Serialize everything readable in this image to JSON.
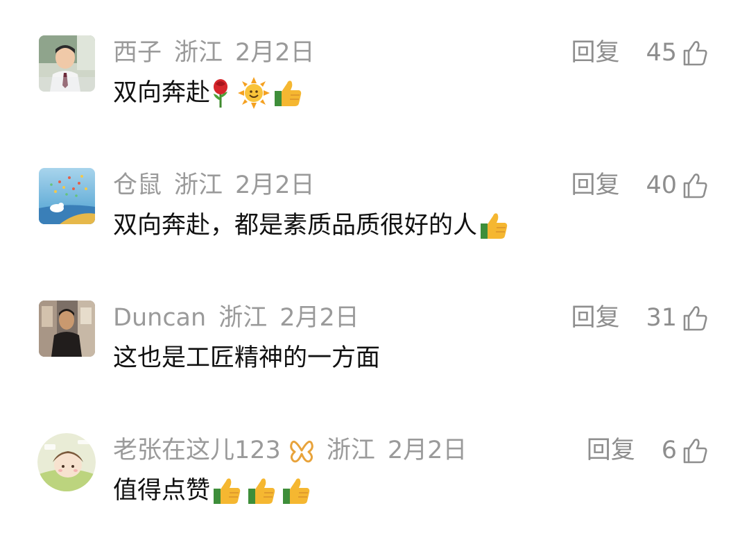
{
  "comments": [
    {
      "name": "西子",
      "region": "浙江",
      "date": "2月2日",
      "reply_label": "回复",
      "likes": "45",
      "text": "双向奔赴",
      "emojis": [
        "rose",
        "sun",
        "thumbs-up"
      ]
    },
    {
      "name": "仓鼠",
      "region": "浙江",
      "date": "2月2日",
      "reply_label": "回复",
      "likes": "40",
      "text": "双向奔赴，都是素质品质很好的人",
      "emojis": [
        "thumbs-up"
      ]
    },
    {
      "name": "Duncan",
      "region": "浙江",
      "date": "2月2日",
      "reply_label": "回复",
      "likes": "31",
      "text": "这也是工匠精神的一方面",
      "emojis": []
    },
    {
      "name": "老张在这儿123",
      "region": "浙江",
      "date": "2月2日",
      "reply_label": "回复",
      "likes": "6",
      "text": "值得点赞",
      "emojis": [
        "thumbs-up",
        "thumbs-up",
        "thumbs-up"
      ],
      "badge": "butterfly-badge-icon"
    }
  ],
  "colors": {
    "meta": "#9a9a9a",
    "text": "#111111",
    "badge": "#e8a33b",
    "thumb": "#f5b731"
  }
}
